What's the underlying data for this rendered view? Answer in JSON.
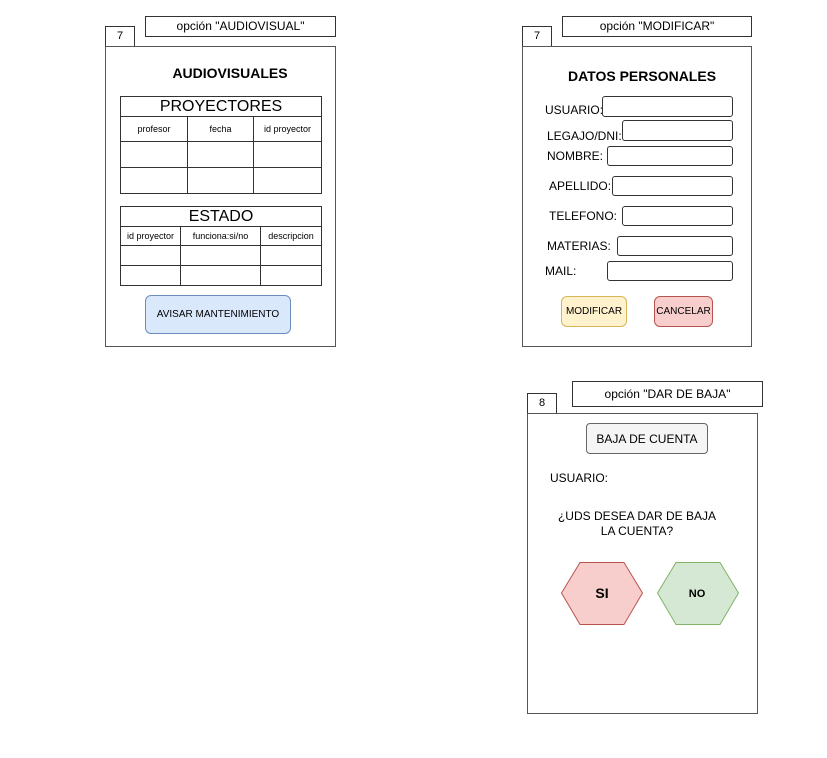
{
  "audiovisual": {
    "option_label": "opción \"AUDIOVISUAL\"",
    "screen_number": "7",
    "title": "AUDIOVISUALES",
    "proyectores": {
      "caption": "PROYECTORES",
      "columns": [
        "profesor",
        "fecha",
        "id proyector"
      ]
    },
    "estado": {
      "caption": "ESTADO",
      "columns": [
        "id proyector",
        "funciona:si/no",
        "descripcion"
      ]
    },
    "button_label": "AVISAR MANTENIMIENTO",
    "button_color": "#dae8fc"
  },
  "modificar": {
    "option_label": "opción \"MODIFICAR\"",
    "screen_number": "7",
    "title": "DATOS PERSONALES",
    "fields": {
      "usuario": "USUARIO:",
      "legajo": "LEGAJO/DNI:",
      "nombre": "NOMBRE:",
      "apellido": "APELLIDO:",
      "telefono": "TELEFONO:",
      "materias": "MATERIAS:",
      "mail": "MAIL:"
    },
    "modificar_label": "MODIFICAR",
    "cancelar_label": "CANCELAR",
    "modificar_color": "#fff2cc",
    "cancelar_color": "#f8cecc"
  },
  "baja": {
    "option_label": "opción \"DAR DE BAJA\"",
    "screen_number": "8",
    "header_label": "BAJA DE CUENTA",
    "usuario_label": "USUARIO:",
    "question_line1": "¿UDS DESEA DAR DE BAJA",
    "question_line2": "LA CUENTA?",
    "si_label": "SI",
    "no_label": "NO",
    "si_color": "#f8cecc",
    "no_color": "#d5e8d4"
  }
}
